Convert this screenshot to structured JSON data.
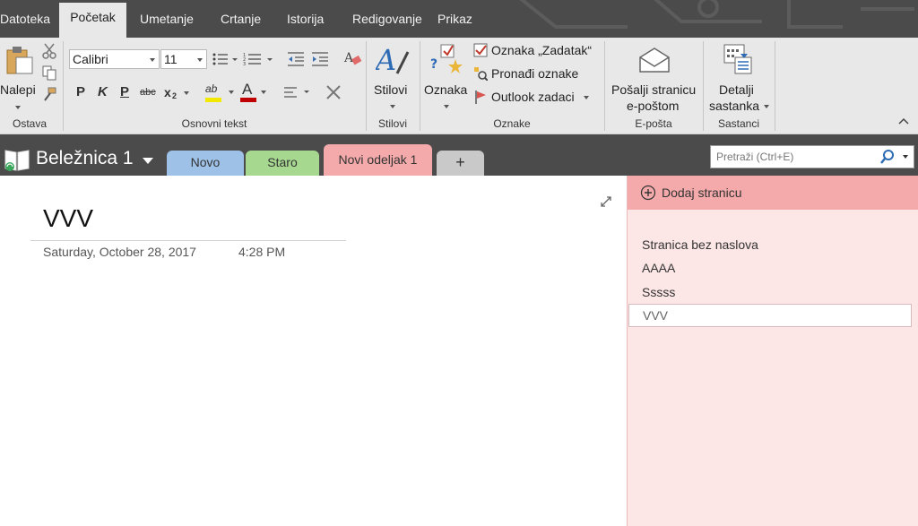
{
  "menu": {
    "tabs": [
      "Datoteka",
      "Početak",
      "Umetanje",
      "Crtanje",
      "Istorija",
      "Redigovanje",
      "Prikaz"
    ],
    "active": "Početak"
  },
  "ribbon": {
    "clipboard": {
      "paste_label": "Nalepi",
      "group_label": "Ostava"
    },
    "basic_text": {
      "font_name": "Calibri",
      "font_size": "11",
      "bold": "P",
      "italic": "K",
      "underline": "P",
      "strike": "abc",
      "subscript": "x",
      "subscript_mark": "2",
      "highlight": "ab",
      "font_color": "A",
      "group_label": "Osnovni tekst"
    },
    "styles": {
      "label": "Stilovi",
      "group_label": "Stilovi"
    },
    "tags": {
      "tag_label": "Oznaka",
      "todo_label": "Oznaka „Zadatak“",
      "find_label": "Pronađi oznake",
      "outlook_label": "Outlook zadaci",
      "group_label": "Oznake"
    },
    "email": {
      "line1": "Pošalji stranicu",
      "line2": "e-poštom",
      "group_label": "E-pošta"
    },
    "meetings": {
      "line1": "Detalji",
      "line2": "sastanka",
      "group_label": "Sastanci"
    }
  },
  "notebook": {
    "name": "Beležnica 1",
    "sections": [
      {
        "label": "Novo",
        "color": "#9ec1e8"
      },
      {
        "label": "Staro",
        "color": "#a6d98f"
      },
      {
        "label": "Novi odeljak 1",
        "color": "#f4aaaa"
      },
      {
        "label": "+",
        "color": "#c9c9c9"
      }
    ],
    "search_placeholder": "Pretraži (Ctrl+E)"
  },
  "page": {
    "title": "VVV",
    "date": "Saturday, October 28, 2017",
    "time": "4:28 PM"
  },
  "pagelist": {
    "add_label": "Dodaj stranicu",
    "items": [
      "Stranica bez naslova",
      "AAAA",
      "Sssss",
      "VVV"
    ],
    "selected": "VVV"
  },
  "colors": {
    "chrome": "#4b4b4b",
    "ribbon": "#e8e8e8",
    "section_accent": "#f4aaaa",
    "pagelist_bg": "#fde6e6"
  }
}
